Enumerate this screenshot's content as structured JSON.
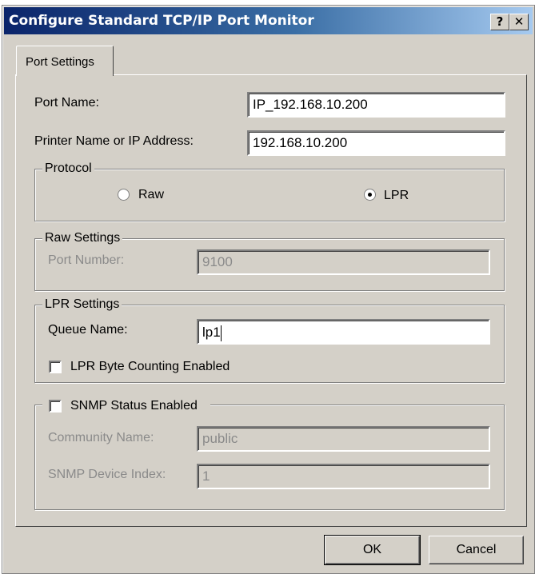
{
  "window": {
    "title": "Configure Standard TCP/IP Port Monitor",
    "help_label": "?",
    "close_label": "✕"
  },
  "tabs": [
    {
      "label": "Port Settings",
      "selected": true
    }
  ],
  "port": {
    "name_label": "Port Name:",
    "name_value": "IP_192.168.10.200",
    "address_label": "Printer Name or IP Address:",
    "address_value": "192.168.10.200"
  },
  "protocol": {
    "legend": "Protocol",
    "raw_label": "Raw",
    "lpr_label": "LPR",
    "selected": "LPR"
  },
  "raw_settings": {
    "legend": "Raw Settings",
    "port_number_label": "Port Number:",
    "port_number_value": "9100"
  },
  "lpr_settings": {
    "legend": "LPR Settings",
    "queue_name_label": "Queue Name:",
    "queue_name_value": "lp1",
    "byte_counting_label": "LPR Byte Counting Enabled",
    "byte_counting_checked": false
  },
  "snmp": {
    "legend": "SNMP Status Enabled",
    "checked": false,
    "community_label": "Community Name:",
    "community_value": "public",
    "device_index_label": "SNMP Device Index:",
    "device_index_value": "1"
  },
  "buttons": {
    "ok": "OK",
    "cancel": "Cancel"
  }
}
